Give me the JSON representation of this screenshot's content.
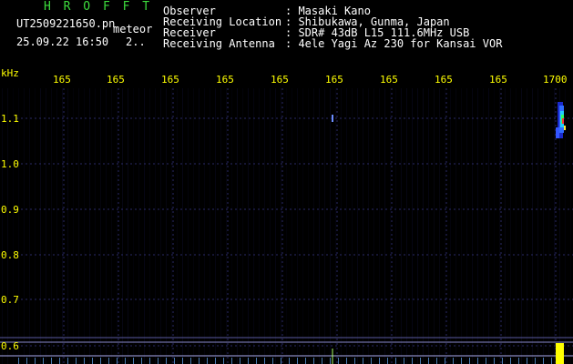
{
  "header": {
    "app_name": "H R O F F T",
    "filename": "UT2509221650.pn",
    "mode": "meteor",
    "date_time": "25.09.22 16:50",
    "count": "2..",
    "info": [
      {
        "label": "Observer",
        "value": ": Masaki Kano"
      },
      {
        "label": "Receiving Location",
        "value": ": Shibukawa, Gunma, Japan"
      },
      {
        "label": "Receiver",
        "value": ": SDR# 43dB L15 111.6MHz USB"
      },
      {
        "label": "Receiving Antenna",
        "value": ": 4ele Yagi Az 230 for Kansai VOR"
      }
    ]
  },
  "time_axis": {
    "labels": [
      "165",
      "165",
      "165",
      "165",
      "165",
      "165",
      "165",
      "165",
      "165",
      "1700"
    ]
  },
  "freq_axis": {
    "unit": "kHz",
    "labels": [
      "1.1",
      "1.0",
      "0.9",
      "0.8",
      "0.7",
      "0.6"
    ]
  },
  "colors": {
    "background": "#000000",
    "header_green": "#3ddc3d",
    "header_white": "#ffffff",
    "axis_yellow": "#ffff00",
    "grid": "#2a2a66",
    "carrier_line": "#5a5aa0"
  }
}
